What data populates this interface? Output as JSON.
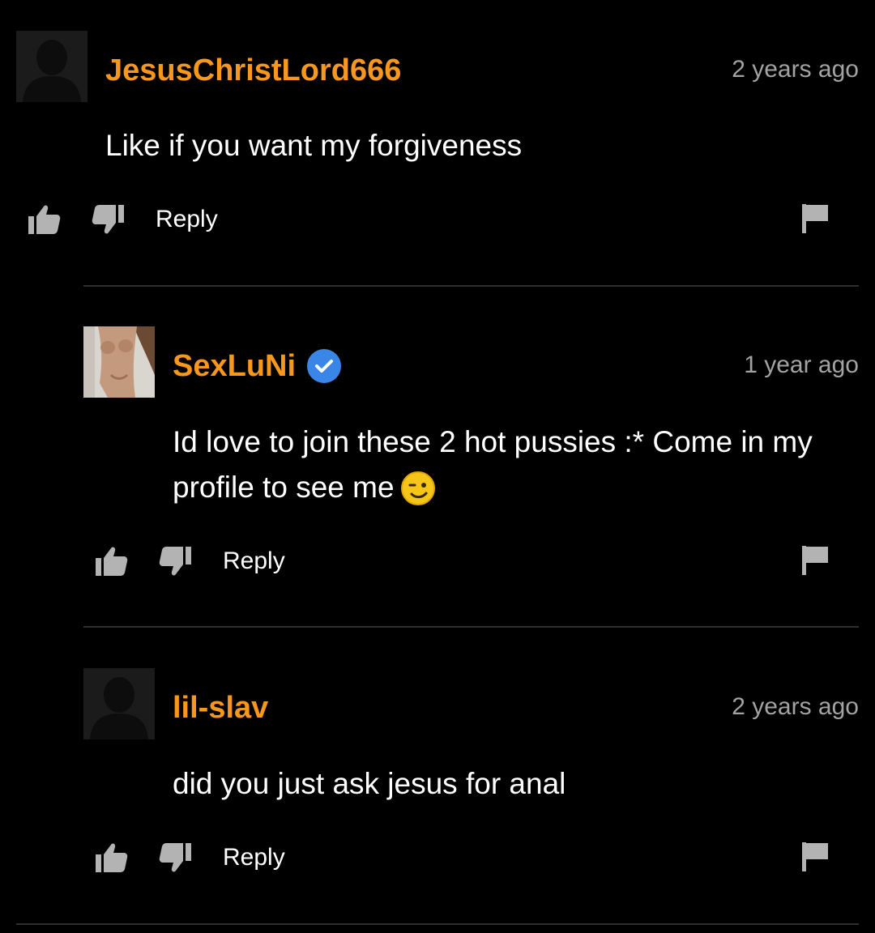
{
  "colors": {
    "background": "#000000",
    "username": "#f7971d",
    "text": "#ffffff",
    "timestamp": "#a3a3a3",
    "icon": "#b3b3b3",
    "divider": "#2f2f2f",
    "verified_badge": "#3a86e8"
  },
  "comments": [
    {
      "username": "JesusChristLord666",
      "timestamp": "2 years ago",
      "text": "Like if you want my forgiveness",
      "reply_label": "Reply",
      "avatar": "default-silhouette",
      "verified": false
    },
    {
      "username": "SexLuNi",
      "timestamp": "1 year ago",
      "text_line1": "Id love to join these 2 hot pussies :* Come in my",
      "text_line2": "profile to see me",
      "emoji": "winking-face",
      "reply_label": "Reply",
      "avatar": "profile-photo",
      "verified": true
    },
    {
      "username": "lil-slav",
      "timestamp": "2 years ago",
      "text": "did you just ask jesus for anal",
      "reply_label": "Reply",
      "avatar": "default-silhouette",
      "verified": false
    }
  ]
}
